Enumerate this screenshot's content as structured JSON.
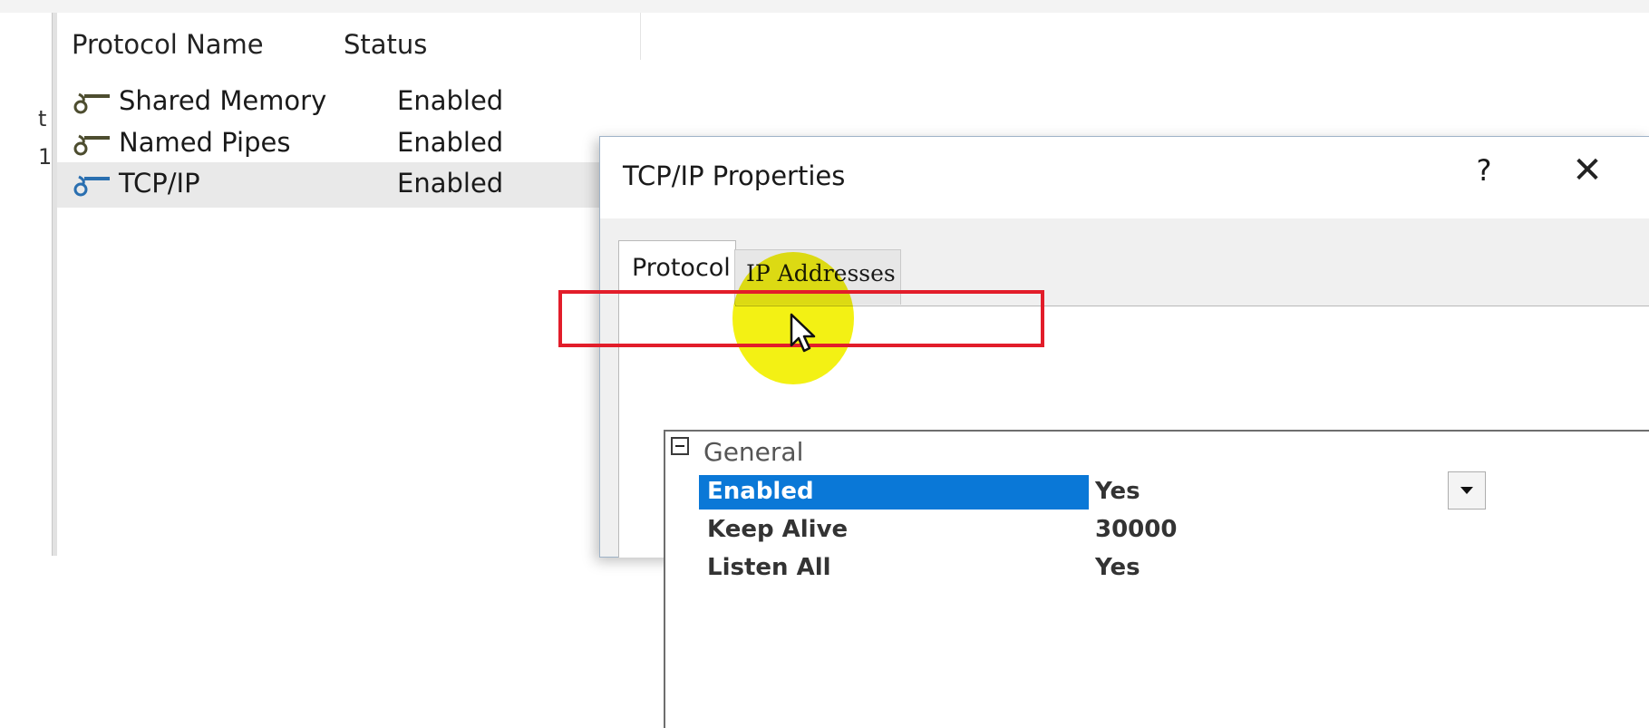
{
  "left_pane": {
    "edge_chars": [
      "t",
      "1"
    ]
  },
  "list": {
    "columns": {
      "name": "Protocol Name",
      "status": "Status"
    },
    "rows": [
      {
        "name": "Shared Memory",
        "status": "Enabled",
        "icon": "protocol-icon"
      },
      {
        "name": "Named Pipes",
        "status": "Enabled",
        "icon": "protocol-icon"
      },
      {
        "name": "TCP/IP",
        "status": "Enabled",
        "icon": "protocol-icon-blue",
        "selected": true
      }
    ]
  },
  "dialog": {
    "title": "TCP/IP Properties",
    "help_label": "?",
    "close_label": "✕",
    "tabs": [
      {
        "label": "Protocol",
        "active": true
      },
      {
        "label": "IP Addresses",
        "active": false
      }
    ],
    "grid": {
      "category": "General",
      "properties": [
        {
          "name": "Enabled",
          "value": "Yes",
          "selected": true
        },
        {
          "name": "Keep Alive",
          "value": "30000"
        },
        {
          "name": "Listen All",
          "value": "Yes"
        }
      ]
    }
  },
  "colors": {
    "selection_blue": "#0a78d7",
    "highlight_red": "#e21d2a",
    "cursor_spot_yellow": "#f2f000",
    "protocol_icon": "#4d4d2f",
    "protocol_icon_blue": "#2a6fb0"
  }
}
